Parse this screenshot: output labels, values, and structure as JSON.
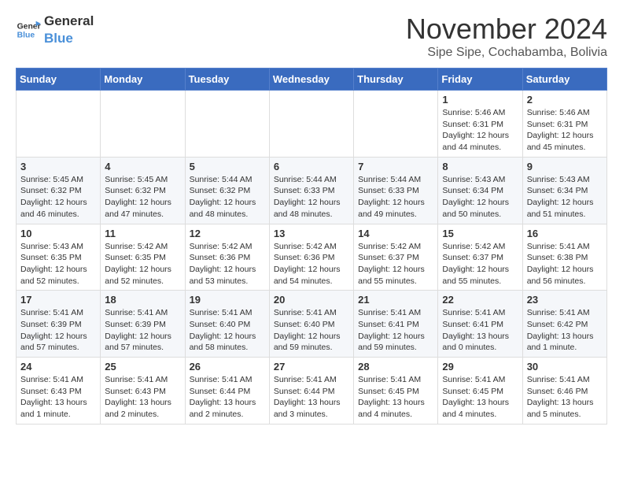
{
  "header": {
    "logo_line1": "General",
    "logo_line2": "Blue",
    "month": "November 2024",
    "location": "Sipe Sipe, Cochabamba, Bolivia"
  },
  "weekdays": [
    "Sunday",
    "Monday",
    "Tuesday",
    "Wednesday",
    "Thursday",
    "Friday",
    "Saturday"
  ],
  "weeks": [
    [
      {
        "day": "",
        "info": ""
      },
      {
        "day": "",
        "info": ""
      },
      {
        "day": "",
        "info": ""
      },
      {
        "day": "",
        "info": ""
      },
      {
        "day": "",
        "info": ""
      },
      {
        "day": "1",
        "info": "Sunrise: 5:46 AM\nSunset: 6:31 PM\nDaylight: 12 hours and 44 minutes."
      },
      {
        "day": "2",
        "info": "Sunrise: 5:46 AM\nSunset: 6:31 PM\nDaylight: 12 hours and 45 minutes."
      }
    ],
    [
      {
        "day": "3",
        "info": "Sunrise: 5:45 AM\nSunset: 6:32 PM\nDaylight: 12 hours and 46 minutes."
      },
      {
        "day": "4",
        "info": "Sunrise: 5:45 AM\nSunset: 6:32 PM\nDaylight: 12 hours and 47 minutes."
      },
      {
        "day": "5",
        "info": "Sunrise: 5:44 AM\nSunset: 6:32 PM\nDaylight: 12 hours and 48 minutes."
      },
      {
        "day": "6",
        "info": "Sunrise: 5:44 AM\nSunset: 6:33 PM\nDaylight: 12 hours and 48 minutes."
      },
      {
        "day": "7",
        "info": "Sunrise: 5:44 AM\nSunset: 6:33 PM\nDaylight: 12 hours and 49 minutes."
      },
      {
        "day": "8",
        "info": "Sunrise: 5:43 AM\nSunset: 6:34 PM\nDaylight: 12 hours and 50 minutes."
      },
      {
        "day": "9",
        "info": "Sunrise: 5:43 AM\nSunset: 6:34 PM\nDaylight: 12 hours and 51 minutes."
      }
    ],
    [
      {
        "day": "10",
        "info": "Sunrise: 5:43 AM\nSunset: 6:35 PM\nDaylight: 12 hours and 52 minutes."
      },
      {
        "day": "11",
        "info": "Sunrise: 5:42 AM\nSunset: 6:35 PM\nDaylight: 12 hours and 52 minutes."
      },
      {
        "day": "12",
        "info": "Sunrise: 5:42 AM\nSunset: 6:36 PM\nDaylight: 12 hours and 53 minutes."
      },
      {
        "day": "13",
        "info": "Sunrise: 5:42 AM\nSunset: 6:36 PM\nDaylight: 12 hours and 54 minutes."
      },
      {
        "day": "14",
        "info": "Sunrise: 5:42 AM\nSunset: 6:37 PM\nDaylight: 12 hours and 55 minutes."
      },
      {
        "day": "15",
        "info": "Sunrise: 5:42 AM\nSunset: 6:37 PM\nDaylight: 12 hours and 55 minutes."
      },
      {
        "day": "16",
        "info": "Sunrise: 5:41 AM\nSunset: 6:38 PM\nDaylight: 12 hours and 56 minutes."
      }
    ],
    [
      {
        "day": "17",
        "info": "Sunrise: 5:41 AM\nSunset: 6:39 PM\nDaylight: 12 hours and 57 minutes."
      },
      {
        "day": "18",
        "info": "Sunrise: 5:41 AM\nSunset: 6:39 PM\nDaylight: 12 hours and 57 minutes."
      },
      {
        "day": "19",
        "info": "Sunrise: 5:41 AM\nSunset: 6:40 PM\nDaylight: 12 hours and 58 minutes."
      },
      {
        "day": "20",
        "info": "Sunrise: 5:41 AM\nSunset: 6:40 PM\nDaylight: 12 hours and 59 minutes."
      },
      {
        "day": "21",
        "info": "Sunrise: 5:41 AM\nSunset: 6:41 PM\nDaylight: 12 hours and 59 minutes."
      },
      {
        "day": "22",
        "info": "Sunrise: 5:41 AM\nSunset: 6:41 PM\nDaylight: 13 hours and 0 minutes."
      },
      {
        "day": "23",
        "info": "Sunrise: 5:41 AM\nSunset: 6:42 PM\nDaylight: 13 hours and 1 minute."
      }
    ],
    [
      {
        "day": "24",
        "info": "Sunrise: 5:41 AM\nSunset: 6:43 PM\nDaylight: 13 hours and 1 minute."
      },
      {
        "day": "25",
        "info": "Sunrise: 5:41 AM\nSunset: 6:43 PM\nDaylight: 13 hours and 2 minutes."
      },
      {
        "day": "26",
        "info": "Sunrise: 5:41 AM\nSunset: 6:44 PM\nDaylight: 13 hours and 2 minutes."
      },
      {
        "day": "27",
        "info": "Sunrise: 5:41 AM\nSunset: 6:44 PM\nDaylight: 13 hours and 3 minutes."
      },
      {
        "day": "28",
        "info": "Sunrise: 5:41 AM\nSunset: 6:45 PM\nDaylight: 13 hours and 4 minutes."
      },
      {
        "day": "29",
        "info": "Sunrise: 5:41 AM\nSunset: 6:45 PM\nDaylight: 13 hours and 4 minutes."
      },
      {
        "day": "30",
        "info": "Sunrise: 5:41 AM\nSunset: 6:46 PM\nDaylight: 13 hours and 5 minutes."
      }
    ]
  ]
}
